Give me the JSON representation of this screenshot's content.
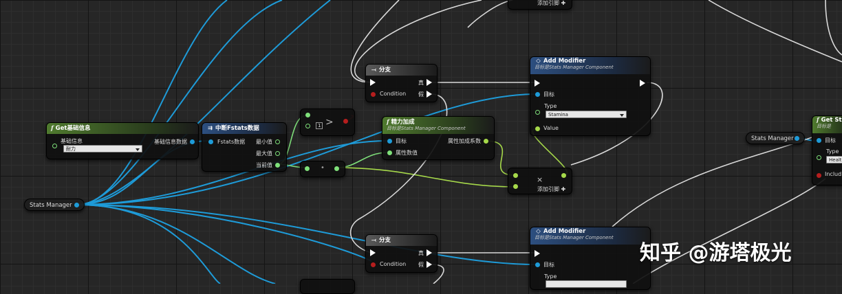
{
  "nodes": {
    "get_base_info": {
      "title": "Get基础信息",
      "pin_label": "基础信息",
      "dropdown": "耐力",
      "out_label": "基础信息数据"
    },
    "break_fstats": {
      "title": "中断Fstats数据",
      "in_label": "Fstats数据",
      "min": "最小值",
      "max": "最大值",
      "cur": "当前值"
    },
    "compare": {
      "value": "1"
    },
    "multiply": {
      "symbol": "•"
    },
    "branch1": {
      "title": "分支",
      "true": "真",
      "condition": "Condition",
      "false": "假"
    },
    "branch2": {
      "title": "分支",
      "true": "真",
      "condition": "Condition",
      "false": "假"
    },
    "spirit_bonus": {
      "title": "精力加成",
      "subtitle": "目标是Stats Manager Component",
      "target": "目标",
      "attr": "属性数值",
      "out": "属性加成系数"
    },
    "add_modifier1": {
      "title": "Add Modifier",
      "subtitle": "目标是Stats Manager Component",
      "target": "目标",
      "type_label": "Type",
      "type_value": "Stamina",
      "value": "Value"
    },
    "add_modifier2": {
      "title": "Add Modifier",
      "subtitle": "目标是Stats Manager Component",
      "target": "目标",
      "type_label": "Type"
    },
    "add_pin_mid": {
      "symbol": "×",
      "label": "添加引脚 ✚"
    },
    "add_pin_top": {
      "label": "添加引脚 ✚"
    },
    "get_stats_right": {
      "title": "Get St",
      "subtitle": "目标是",
      "target": "目标",
      "type_label": "Type",
      "type_value": "Healt",
      "include": "Includ"
    }
  },
  "variables": {
    "stats_manager_left": "Stats Manager",
    "stats_manager_right": "Stats Manager"
  },
  "watermark": "知乎 @游塔极光",
  "colors": {
    "object_wire": "#1e9bd8",
    "float_wire": "#a6d94a",
    "exec_wire": "#d9d9d9",
    "bool_pin": "#b51e1e"
  }
}
